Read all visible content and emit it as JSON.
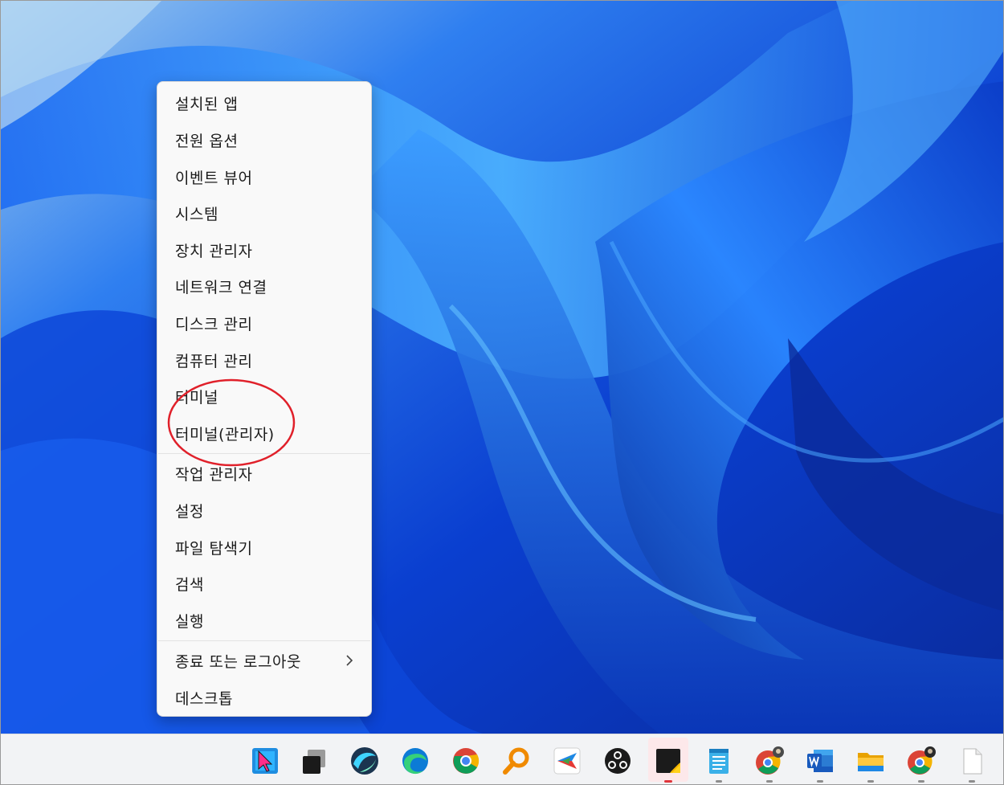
{
  "context_menu": {
    "items": [
      {
        "label": "설치된 앱"
      },
      {
        "label": "전원 옵션"
      },
      {
        "label": "이벤트 뷰어"
      },
      {
        "label": "시스템"
      },
      {
        "label": "장치 관리자"
      },
      {
        "label": "네트워크 연결"
      },
      {
        "label": "디스크 관리"
      },
      {
        "label": "컴퓨터 관리"
      },
      {
        "label": "터미널"
      },
      {
        "label": "터미널(관리자)"
      },
      {
        "label": "작업 관리자"
      },
      {
        "label": "설정"
      },
      {
        "label": "파일 탐색기"
      },
      {
        "label": "검색"
      },
      {
        "label": "실행"
      },
      {
        "label": "종료 또는 로그아웃",
        "icon": "chevron-right-icon"
      },
      {
        "label": "데스크톱"
      }
    ],
    "highlighted_items": [
      "터미널",
      "터미널(관리자)"
    ],
    "highlight_color": "#e0202a"
  },
  "taskbar": {
    "icons": [
      {
        "name": "snipping-tool-icon"
      },
      {
        "name": "task-view-icon"
      },
      {
        "name": "sharex-icon"
      },
      {
        "name": "edge-icon"
      },
      {
        "name": "chrome-icon"
      },
      {
        "name": "search-magnifier-icon"
      },
      {
        "name": "paint-app-icon"
      },
      {
        "name": "obs-studio-icon"
      },
      {
        "name": "sticky-notes-icon",
        "active": true
      },
      {
        "name": "notepad-icon"
      },
      {
        "name": "chrome-profile-icon"
      },
      {
        "name": "word-icon"
      },
      {
        "name": "file-explorer-icon"
      },
      {
        "name": "chrome-profile-2-icon"
      },
      {
        "name": "blank-document-icon"
      }
    ]
  },
  "colors": {
    "wallpaper_base": "#0a3fd0",
    "wallpaper_light": "#3aa0ff",
    "menu_background": "#f9f9f9",
    "taskbar_background": "#f2f3f5"
  }
}
